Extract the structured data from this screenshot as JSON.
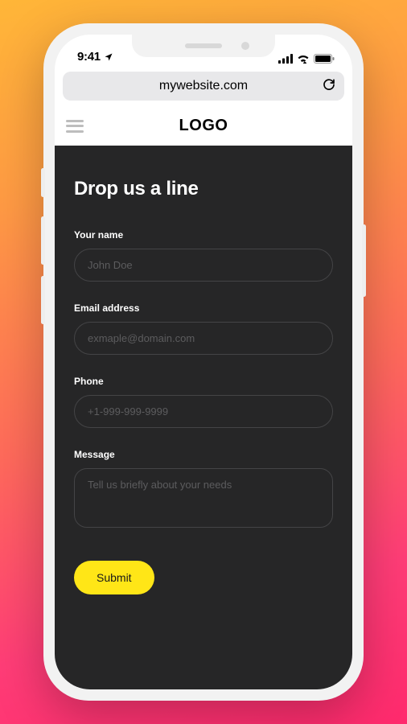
{
  "status": {
    "time": "9:41"
  },
  "browser": {
    "url": "mywebsite.com"
  },
  "header": {
    "logo": "LOGO"
  },
  "form": {
    "heading": "Drop us a line",
    "name": {
      "label": "Your name",
      "placeholder": "John Doe",
      "value": ""
    },
    "email": {
      "label": "Email address",
      "placeholder": "exmaple@domain.com",
      "value": ""
    },
    "phone": {
      "label": "Phone",
      "placeholder": "+1-999-999-9999",
      "value": ""
    },
    "message": {
      "label": "Message",
      "placeholder": "Tell us briefly about your needs",
      "value": ""
    },
    "submit_label": "Submit"
  }
}
